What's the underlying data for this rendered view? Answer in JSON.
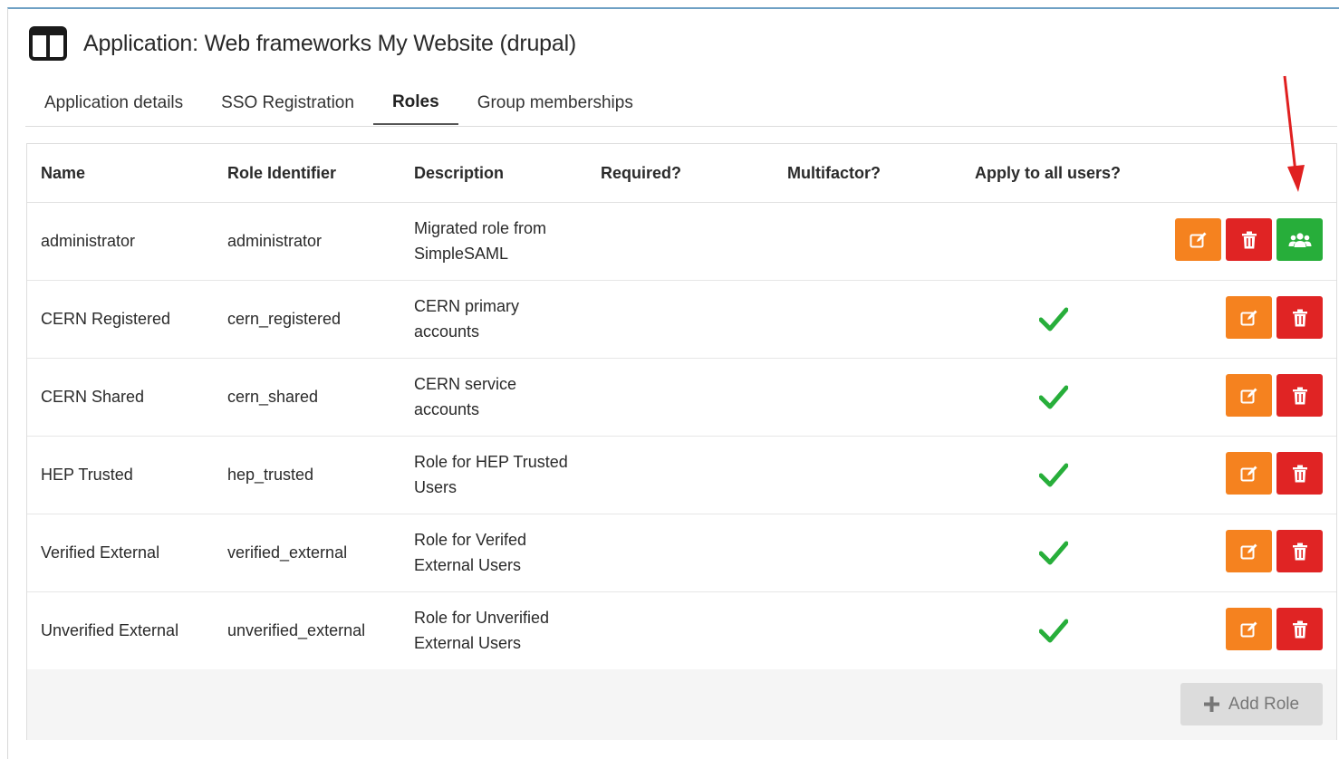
{
  "header": {
    "title": "Application: Web frameworks My Website (drupal)",
    "icon": "columns-icon"
  },
  "tabs": [
    {
      "label": "Application details",
      "active": false
    },
    {
      "label": "SSO Registration",
      "active": false
    },
    {
      "label": "Roles",
      "active": true
    },
    {
      "label": "Group memberships",
      "active": false
    }
  ],
  "table": {
    "headers": {
      "name": "Name",
      "role_identifier": "Role Identifier",
      "description": "Description",
      "required": "Required?",
      "multifactor": "Multifactor?",
      "apply_all": "Apply to all users?"
    },
    "rows": [
      {
        "name": "administrator",
        "identifier": "administrator",
        "desc1": "Migrated role from",
        "desc2": "SimpleSAML",
        "apply_all": false,
        "has_group_button": true
      },
      {
        "name": "CERN Registered",
        "identifier": "cern_registered",
        "desc1": "CERN primary",
        "desc2": "accounts",
        "apply_all": true,
        "has_group_button": false
      },
      {
        "name": "CERN Shared",
        "identifier": "cern_shared",
        "desc1": "CERN service",
        "desc2": "accounts",
        "apply_all": true,
        "has_group_button": false
      },
      {
        "name": "HEP Trusted",
        "identifier": "hep_trusted",
        "desc1": "Role for HEP Trusted",
        "desc2": "Users",
        "apply_all": true,
        "has_group_button": false
      },
      {
        "name": "Verified External",
        "identifier": "verified_external",
        "desc1": "Role for Verifed",
        "desc2": "External Users",
        "apply_all": true,
        "has_group_button": false
      },
      {
        "name": "Unverified External",
        "identifier": "unverified_external",
        "desc1": "Role for Unverified",
        "desc2": "External Users",
        "apply_all": true,
        "has_group_button": false
      }
    ]
  },
  "footer": {
    "add_role_label": "Add Role"
  },
  "colors": {
    "edit": "#f5821f",
    "delete": "#e02424",
    "group": "#27ae3a",
    "check": "#27ae3a",
    "arrow": "#e02020"
  }
}
